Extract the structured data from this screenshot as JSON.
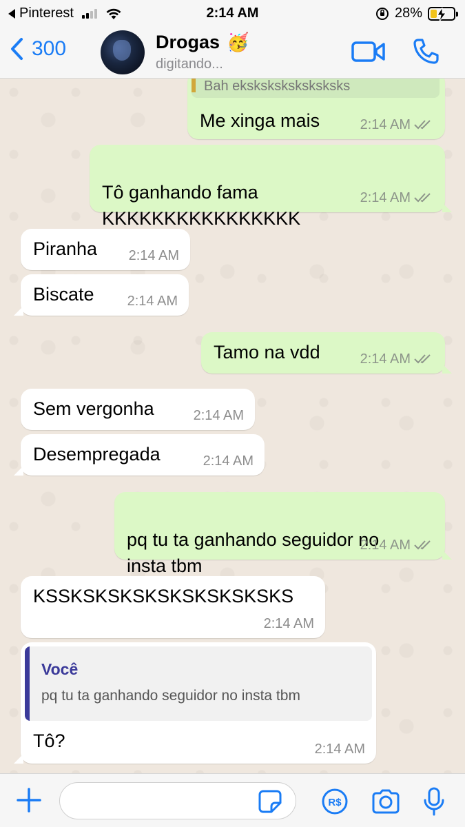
{
  "status_bar": {
    "back_app": "Pinterest",
    "time": "2:14 AM",
    "battery": "28%",
    "battery_level": 0.28
  },
  "header": {
    "back_count": "300",
    "contact_name": "Drogas",
    "contact_emoji": "🥳",
    "contact_status": "digitando...",
    "accent_color": "#1a7cf5"
  },
  "chat": {
    "partial_quote_text": "Bah eksksksksksksksks",
    "messages": [
      {
        "dir": "out",
        "text": "Me xinga mais",
        "time": "2:14 AM",
        "read": true
      },
      {
        "dir": "out",
        "text": "Tô ganhando fama\nKKKKKKKKKKKKKKKK",
        "time": "2:14 AM",
        "read": true
      },
      {
        "dir": "in",
        "text": "Piranha",
        "time": "2:14 AM"
      },
      {
        "dir": "in",
        "text": "Biscate",
        "time": "2:14 AM"
      },
      {
        "dir": "out",
        "text": "Tamo na vdd",
        "time": "2:14 AM",
        "read": true
      },
      {
        "dir": "in",
        "text": "Sem vergonha",
        "time": "2:14 AM"
      },
      {
        "dir": "in",
        "text": "Desempregada",
        "time": "2:14 AM"
      },
      {
        "dir": "out",
        "text": "pq tu ta ganhando seguidor no\ninsta tbm",
        "time": "2:14 AM",
        "read": true
      },
      {
        "dir": "in",
        "text": "KSSKSKSKSKSKSKSKSKSKS",
        "time": "2:14 AM"
      },
      {
        "dir": "in",
        "text": "Tô?",
        "time": "2:14 AM",
        "quote": {
          "author": "Você",
          "text": "pq tu ta ganhando seguidor no insta tbm"
        }
      }
    ],
    "colors": {
      "outgoing": "#dcf8c6",
      "incoming": "#ffffff",
      "quote_author": "#3b3a9a"
    }
  },
  "composer": {
    "input_value": "",
    "icons": [
      "plus-icon",
      "sticker-icon",
      "payment-icon",
      "camera-icon",
      "microphone-icon"
    ]
  }
}
